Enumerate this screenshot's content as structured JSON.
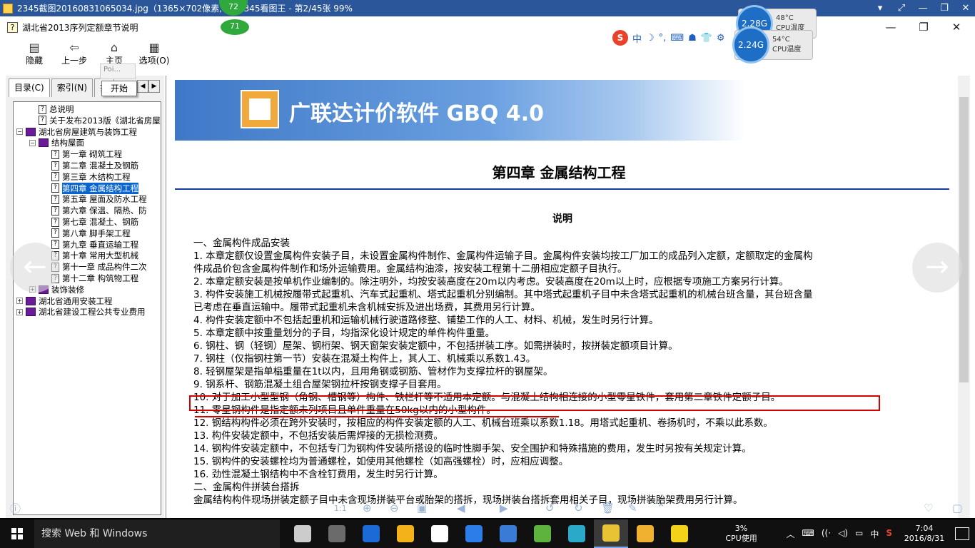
{
  "viewer": {
    "title": "2345截图20160831065034.jpg（1365×702像素, 22    2345看图王 - 第2/45张 99%",
    "controls": [
      "▾",
      "⤢",
      "—",
      "❐",
      "✕"
    ],
    "badges": {
      "top": "72",
      "bottom": "71"
    }
  },
  "help": {
    "title": "湖北省2013序列定额章节说明",
    "toolbar": [
      {
        "icon": "▤",
        "label": "隐藏"
      },
      {
        "icon": "⇦",
        "label": "上一步"
      },
      {
        "icon": "⌂",
        "label": "主页"
      },
      {
        "icon": "▦",
        "label": "选项(O)"
      }
    ],
    "tooltip": "Poi...",
    "popup_start": "开始",
    "tabs": [
      "目录(C)",
      "索引(N)",
      "搜"
    ],
    "tree": [
      {
        "label": "总说明",
        "indent": 1,
        "kind": "page"
      },
      {
        "label": "关于发布2013版《湖北省房屋",
        "indent": 1,
        "kind": "page"
      },
      {
        "label": "湖北省房屋建筑与装饰工程",
        "indent": 0,
        "kind": "book",
        "exp": "⊟"
      },
      {
        "label": "结构屋面",
        "indent": 1,
        "kind": "book",
        "exp": "⊟"
      },
      {
        "label": "第一章 砌筑工程",
        "indent": 2,
        "kind": "page"
      },
      {
        "label": "第二章 混凝土及钢筋",
        "indent": 2,
        "kind": "page"
      },
      {
        "label": "第三章 木结构工程",
        "indent": 2,
        "kind": "page"
      },
      {
        "label": "第四章 金属结构工程",
        "indent": 2,
        "kind": "page",
        "selected": true
      },
      {
        "label": "第五章 屋面及防水工程",
        "indent": 2,
        "kind": "page"
      },
      {
        "label": "第六章 保温、隔热、防",
        "indent": 2,
        "kind": "page"
      },
      {
        "label": "第七章 混凝土、钢筋",
        "indent": 2,
        "kind": "page"
      },
      {
        "label": "第八章 脚手架工程",
        "indent": 2,
        "kind": "page"
      },
      {
        "label": "第九章 垂直运输工程",
        "indent": 2,
        "kind": "page"
      },
      {
        "label": "第十章 常用大型机械",
        "indent": 2,
        "kind": "page"
      },
      {
        "label": "第十一章 成品构件二次",
        "indent": 2,
        "kind": "page"
      },
      {
        "label": "第十二章 构筑物工程",
        "indent": 2,
        "kind": "page"
      },
      {
        "label": "装饰装修",
        "indent": 1,
        "kind": "book",
        "exp": "⊞"
      },
      {
        "label": "湖北省通用安装工程",
        "indent": 0,
        "kind": "book",
        "exp": "⊞"
      },
      {
        "label": "湖北省建设工程公共专业费用",
        "indent": 0,
        "kind": "book",
        "exp": "⊞"
      }
    ]
  },
  "doc": {
    "banner_text": "广联达计价软件 GBQ 4.0",
    "chapter_title": "第四章  金属结构工程",
    "subtitle": "说明",
    "lines": [
      "一、金属构件成品安装",
      "1. 本章定额仅设置金属构件安装子目，未设置金属构件制作、金属构件运输子目。金属构件安装均按工厂加工的成品列入定额，定额取定的金属构",
      "件成品价包含金属构件制作和场外运输费用。金属结构油漆，按安装工程第十二册相应定额子目执行。",
      "2. 本章定额安装是按单机作业编制的。除注明外，均按安装高度在20m以内考虑。安装高度在20m以上时，应根据专项施工方案另行计算。",
      "3. 构件安装施工机械按履带式起重机、汽车式起重机、塔式起重机分别编制。其中塔式起重机子目中未含塔式起重机的机械台班含量，其台班含量",
      "已考虑在垂直运输中。履带式起重机未含机械安拆及进出场费，其费用另行计算。",
      "4. 构件安装定额中不包括起重机和运输机械行驶道路修整、铺垫工作的人工、材料、机械，发生时另行计算。",
      "5. 本章定额中按重量划分的子目，均指深化设计规定的单件构件重量。",
      "6. 钢柱、钢（轻钢）屋架、钢桁架、钢天窗架安装定额中，不包括拼装工序。如需拼装时，按拼装定额项目计算。",
      "7. 钢柱（仅指钢柱第一节）安装在混凝土构件上，其人工、机械乘以系数1.43。",
      "8. 轻钢屋架是指单榀重量在1t以内，且用角钢或钢筋、管材作为支撑拉杆的钢屋架。",
      "9. 钢系杆、钢筋混凝土组合屋架钢拉杆按钢支撑子目套用。",
      "10. 对于加工小型型钢（角钢、槽钢等）构件、铁栏杆等不适用本定额。与混凝土结构相连接的小型零星铁件，套用第二章铁件定额子目。",
      "11. 零星钢构件是指定额未列项目且单件重量在50kg以内的小型构件。",
      "12. 钢结构构件必须在跨外安装时，按相应的构件安装定额的人工、机械台班乘以系数1.18。用塔式起重机、卷扬机时，不乘以此系数。",
      "13. 构件安装定额中，不包括安装后需焊接的无损检测费。",
      "14. 钢构件安装定额中，不包括专门为钢构件安装所搭设的临时性脚手架、安全围护和特殊措施的费用，发生时另按有关规定计算。",
      "15. 钢构件的安装螺栓均为普通螺栓，如使用其他螺栓（如高强螺栓）时，应相应调整。",
      "16. 劲性混凝土钢结构中不含栓钉费用，发生时另行计算。",
      "二、金属构件拼装台搭拆",
      "金属结构构件现场拼装定额子目中未含现场拼装平台或胎架的搭拆，现场拼装台搭拆套用相关子目，现场拼装胎架费用另行计算。"
    ]
  },
  "overlay": {
    "cpu1": {
      "freq": "2.28G",
      "temp": "48°C",
      "label": "CPU温度"
    },
    "cpu2": {
      "freq": "2.24G",
      "temp": "54°C",
      "label": "CPU温度"
    },
    "ime": [
      "中",
      "☽",
      "°,",
      "⌨",
      "☗",
      "👕",
      "⚙"
    ],
    "ime_logo": "S",
    "left_arrow": "←",
    "right_arrow": "→",
    "zoom_label": "1:1"
  },
  "taskbar": {
    "search_placeholder": "搜索 Web 和 Windows",
    "cpu_percent": "3%",
    "cpu_label": "CPU使用",
    "time": "7:04",
    "date": "2016/8/31",
    "tray_lang": "中",
    "tray_icons": [
      "︿",
      "⌨",
      "((·",
      "◁)",
      "▭"
    ],
    "app_colors": [
      "#cccccc",
      "#6b6b6b",
      "#1b6ad6",
      "#f3b21a",
      "#ffffff",
      "#2b7de9",
      "#3a7bd5",
      "#5db33e",
      "#2aa9c9",
      "#e8c434",
      "#f0b030",
      "#f4d21a"
    ]
  }
}
